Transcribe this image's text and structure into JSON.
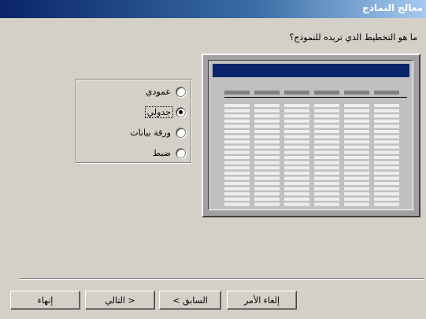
{
  "window": {
    "title": "معالج النماذج"
  },
  "prompt": "ما هو التخطيط الذي تريده للنموذج؟",
  "layout_options": [
    {
      "label": "عمودي",
      "checked": false
    },
    {
      "label": "جدولي",
      "checked": true
    },
    {
      "label": "ورقة بيانات",
      "checked": false
    },
    {
      "label": "ضبط",
      "checked": false
    }
  ],
  "buttons": {
    "cancel": "إلغاء الأمر",
    "back": "< السابق",
    "next": "التالي >",
    "finish": "إنهاء"
  },
  "colors": {
    "title_bar": "#0a246a",
    "face": "#d4d0c8",
    "preview_header": "#0a246a"
  }
}
